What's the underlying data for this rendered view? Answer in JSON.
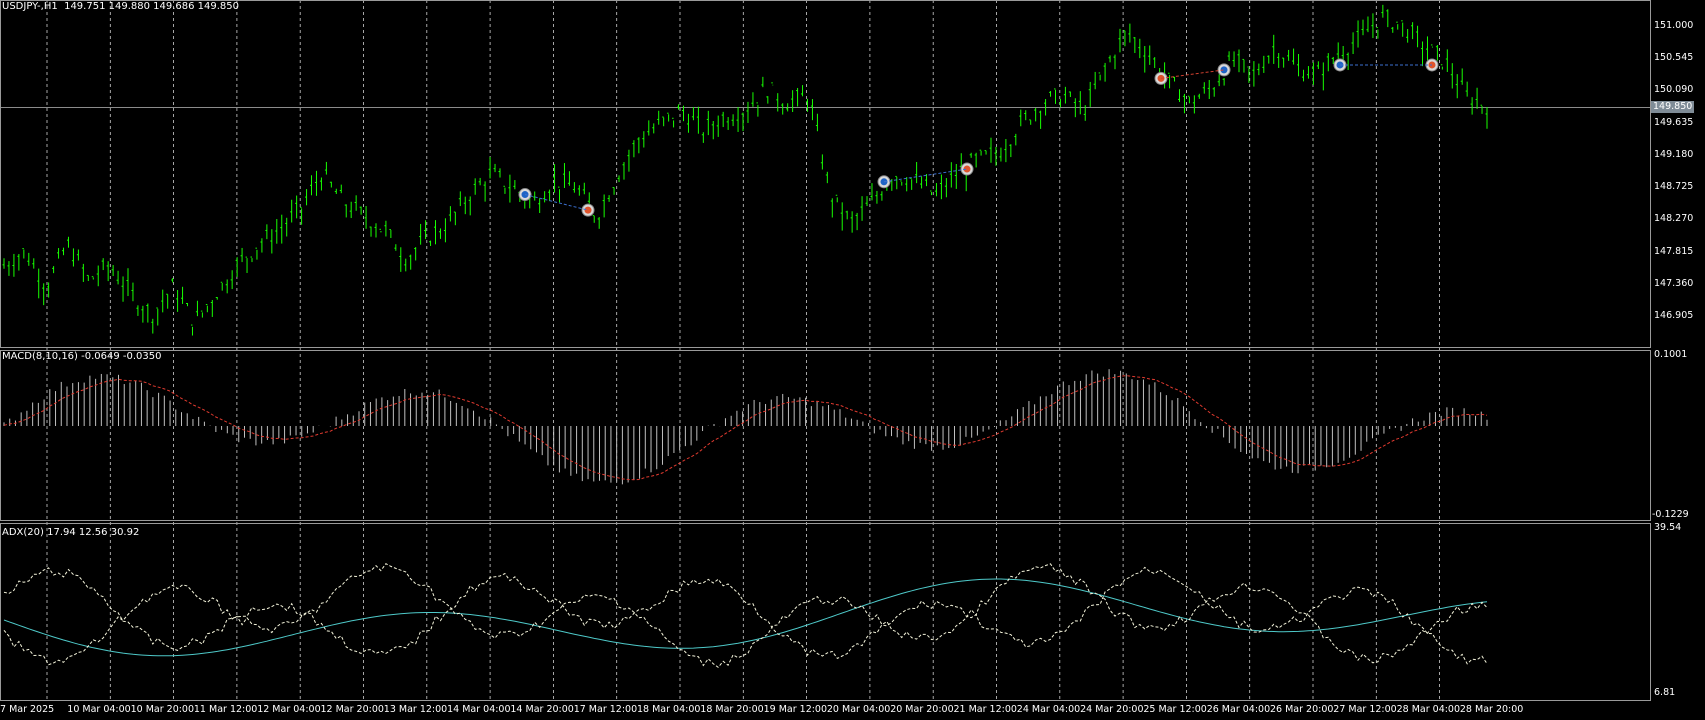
{
  "main_panel": {
    "title": "USDJPY-,H1  149.751 149.880 149.686 149.850",
    "current_price": "149.850",
    "price_ticks": [
      "151.000",
      "150.545",
      "150.090",
      "149.635",
      "149.180",
      "148.725",
      "148.270",
      "147.815",
      "147.360",
      "146.905"
    ],
    "colors": {
      "candle": "#17ff00",
      "grid": "#ffffff",
      "price_line": "#8b8b8b",
      "bid_badge": "#7f8c97"
    }
  },
  "macd_panel": {
    "title": "MACD(8,10,16) -0.0649 -0.0350",
    "ticks": [
      "0.1001",
      "-0.1229"
    ],
    "colors": {
      "histogram": "#c0c0c0",
      "signal": "#e03a2f"
    }
  },
  "adx_panel": {
    "title": "ADX(20) 17.94 12.56 30.92",
    "ticks": [
      "39.54",
      "6.81"
    ],
    "colors": {
      "adx_line": "#4ec9c9",
      "di_lines": "#f5f5dc"
    }
  },
  "time_axis": {
    "labels": [
      "7 Mar 2025",
      "10 Mar 04:00",
      "10 Mar 20:00",
      "11 Mar 12:00",
      "12 Mar 04:00",
      "12 Mar 20:00",
      "13 Mar 12:00",
      "14 Mar 04:00",
      "14 Mar 20:00",
      "17 Mar 12:00",
      "18 Mar 04:00",
      "18 Mar 20:00",
      "19 Mar 12:00",
      "20 Mar 04:00",
      "20 Mar 20:00",
      "21 Mar 12:00",
      "24 Mar 04:00",
      "24 Mar 20:00",
      "25 Mar 12:00",
      "26 Mar 04:00",
      "26 Mar 20:00",
      "27 Mar 12:00",
      "28 Mar 04:00",
      "28 Mar 20:00"
    ]
  },
  "chart_data": {
    "type": "candlestick",
    "symbol": "USDJPY-",
    "timeframe": "H1",
    "ohlc_last": {
      "open": 149.751,
      "high": 149.88,
      "low": 149.686,
      "close": 149.85
    },
    "price_path": [
      147.6,
      147.8,
      147.3,
      147.9,
      147.4,
      147.6,
      147.2,
      146.9,
      147.3,
      146.8,
      147.2,
      147.6,
      147.9,
      148.1,
      148.4,
      148.9,
      148.5,
      148.3,
      148.1,
      147.7,
      148.0,
      148.2,
      148.6,
      148.9,
      148.7,
      148.5,
      148.8,
      148.7,
      148.3,
      148.9,
      149.4,
      149.6,
      149.8,
      149.5,
      149.7,
      149.8,
      150.1,
      149.9,
      150.0,
      148.6,
      148.2,
      148.5,
      148.9,
      148.8,
      148.6,
      148.9,
      149.1,
      149.2,
      149.6,
      149.9,
      150.0,
      149.8,
      150.4,
      150.9,
      150.6,
      150.2,
      149.9,
      150.1,
      150.5,
      150.3,
      150.7,
      150.4,
      150.3,
      150.6,
      150.8,
      151.1,
      151.0,
      150.7,
      150.5,
      150.0,
      149.85
    ],
    "markers": [
      {
        "type": "buy",
        "price": 148.62
      },
      {
        "type": "sell",
        "price": 148.4
      },
      {
        "type": "buy",
        "price": 148.8
      },
      {
        "type": "sell",
        "price": 148.98
      },
      {
        "type": "sell",
        "price": 150.26
      },
      {
        "type": "buy",
        "price": 150.38
      },
      {
        "type": "buy",
        "price": 150.45
      },
      {
        "type": "sell",
        "price": 150.45
      }
    ],
    "macd": {
      "value": -0.0649,
      "signal": -0.035,
      "ylim": [
        -0.1229,
        0.1001
      ]
    },
    "adx": {
      "adx": 17.94,
      "plus_di": 12.56,
      "minus_di": 30.92,
      "ylim": [
        6.81,
        39.54
      ]
    }
  }
}
